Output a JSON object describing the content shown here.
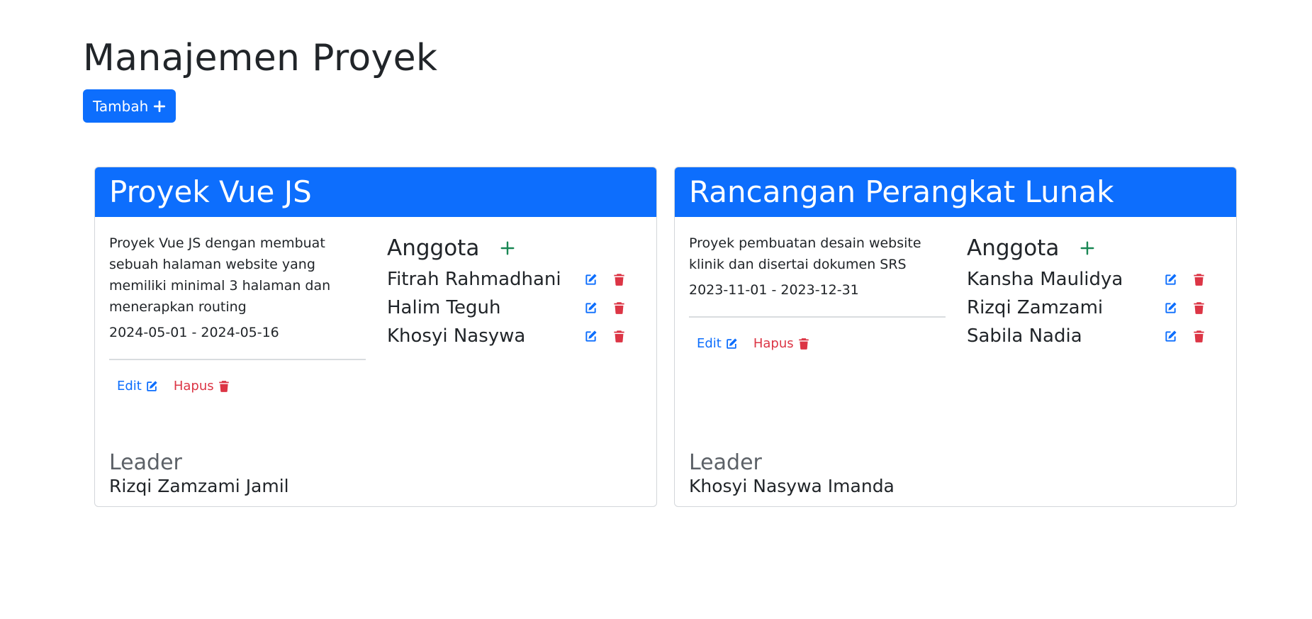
{
  "page": {
    "title": "Manajemen Proyek",
    "add_button_label": "Tambah"
  },
  "colors": {
    "primary": "#0d6efd",
    "danger": "#dc3545",
    "success": "#198754",
    "muted": "#5c6167"
  },
  "projects": [
    {
      "title": "Proyek Vue JS",
      "description": "Proyek Vue JS dengan membuat sebuah halaman website yang memiliki minimal 3 halaman dan menerapkan routing",
      "dates": "2024-05-01 - 2024-05-16",
      "edit_label": "Edit",
      "delete_label": "Hapus",
      "members_title": "Anggota",
      "members": [
        "Fitrah Rahmadhani",
        "Halim Teguh",
        "Khosyi Nasywa"
      ],
      "leader_label": "Leader",
      "leader_name": "Rizqi Zamzami Jamil"
    },
    {
      "title": "Rancangan Perangkat Lunak",
      "description": "Proyek pembuatan desain website klinik dan disertai dokumen SRS",
      "dates": "2023-11-01 - 2023-12-31",
      "edit_label": "Edit",
      "delete_label": "Hapus",
      "members_title": "Anggota",
      "members": [
        "Kansha Maulidya",
        "Rizqi Zamzami",
        "Sabila Nadia"
      ],
      "leader_label": "Leader",
      "leader_name": "Khosyi Nasywa Imanda"
    }
  ]
}
